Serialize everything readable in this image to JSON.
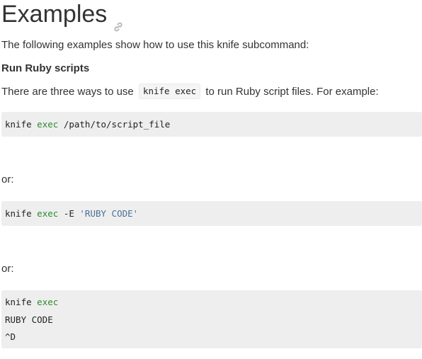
{
  "heading": {
    "title": "Examples",
    "anchor_icon": "link-icon"
  },
  "intro_text": "The following examples show how to use this knife subcommand:",
  "subheading": "Run Ruby scripts",
  "ways_text": {
    "before": "There are three ways to use",
    "code": "knife exec",
    "after": "to run Ruby script files. For example:"
  },
  "code_blocks": [
    {
      "lines": [
        {
          "cmd": "knife",
          "keyword": "exec",
          "rest": "/path/to/script_file"
        }
      ]
    },
    {
      "lines": [
        {
          "cmd": "knife",
          "keyword": "exec",
          "rest": "-E",
          "string": "'RUBY CODE'"
        }
      ]
    },
    {
      "lines": [
        {
          "cmd": "knife",
          "keyword": "exec"
        },
        {
          "text": "RUBY CODE"
        },
        {
          "text": "^D"
        }
      ]
    }
  ],
  "separators": [
    "or:",
    "or:"
  ],
  "colors": {
    "text": "#333333",
    "code_background": "#eeeeee",
    "keyword": "#2e8b2e",
    "string": "#4a6f9a",
    "link_icon": "#b5b5b5"
  }
}
